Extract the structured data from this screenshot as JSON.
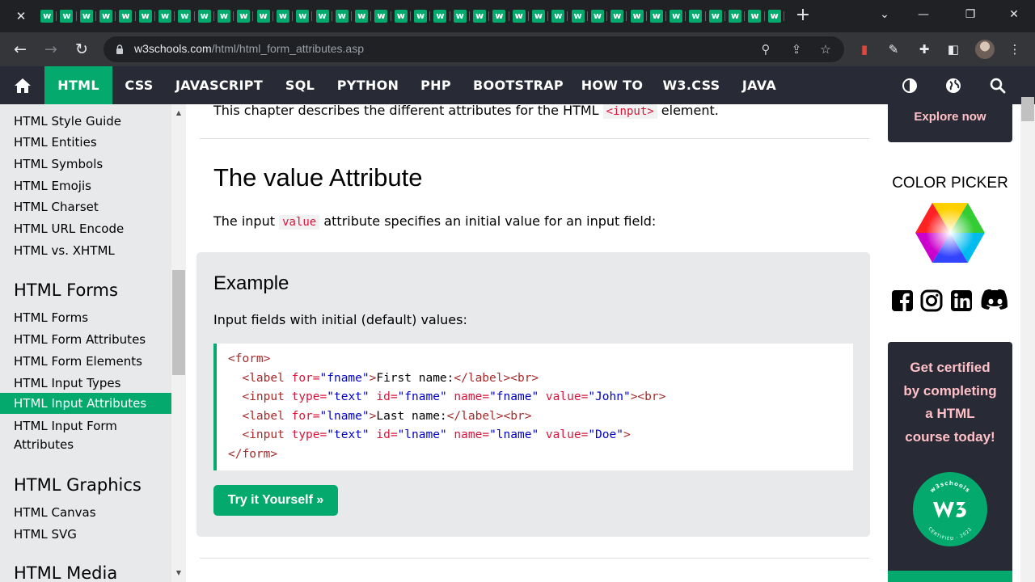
{
  "browser": {
    "tab_favicon_letter": "w",
    "tab_count": 38,
    "new_tab_symbol": "+",
    "close_symbol": "✕",
    "url_host": "w3schools.com",
    "url_path": "/html/html_form_attributes.asp"
  },
  "nav": {
    "items": [
      "HTML",
      "CSS",
      "JAVASCRIPT",
      "SQL",
      "PYTHON",
      "PHP",
      "BOOTSTRAP",
      "HOW TO",
      "W3.CSS",
      "JAVA"
    ],
    "active": "HTML",
    "accent": "#04aa6d",
    "background": "#282a35"
  },
  "sidebar": {
    "links_top": [
      "HTML Style Guide",
      "HTML Entities",
      "HTML Symbols",
      "HTML Emojis",
      "HTML Charset",
      "HTML URL Encode",
      "HTML vs. XHTML"
    ],
    "forms_heading": "HTML Forms",
    "forms_links": [
      "HTML Forms",
      "HTML Form Attributes",
      "HTML Form Elements",
      "HTML Input Types",
      "HTML Input Attributes"
    ],
    "input_form_line1": "HTML Input Form",
    "input_form_line2": "Attributes",
    "graphics_heading": "HTML Graphics",
    "graphics_links": [
      "HTML Canvas",
      "HTML SVG"
    ],
    "media_heading": "HTML Media"
  },
  "main": {
    "intro_before": "This chapter describes the different attributes for the HTML ",
    "intro_code": "<input>",
    "intro_after": " element.",
    "heading": "The value Attribute",
    "para_before": "The input ",
    "para_code": "value",
    "para_after": " attribute specifies an initial value for an input field:",
    "example_title": "Example",
    "example_desc": "Input fields with initial (default) values:",
    "try_button": "Try it Yourself »"
  },
  "right": {
    "explore": "Explore now",
    "color_picker": "COLOR PICKER",
    "cert_line1": "Get certified",
    "cert_line2": "by completing",
    "cert_line3": "a HTML",
    "cert_line4": "course today!",
    "badge_top": "w3schools",
    "badge_bottom": "CERTIFIED · 2022"
  }
}
